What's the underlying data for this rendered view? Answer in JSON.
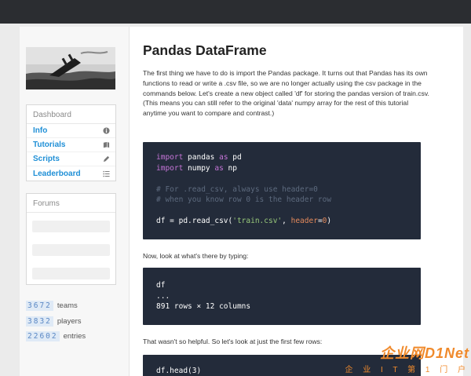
{
  "sidebar": {
    "dashboard_title": "Dashboard",
    "nav": [
      {
        "label": "Info",
        "icon": "info-icon"
      },
      {
        "label": "Tutorials",
        "icon": "book-icon"
      },
      {
        "label": "Scripts",
        "icon": "pencil-icon"
      },
      {
        "label": "Leaderboard",
        "icon": "list-icon"
      }
    ],
    "forums_title": "Forums",
    "stats": [
      {
        "value": "3672",
        "label": "teams"
      },
      {
        "value": "3832",
        "label": "players"
      },
      {
        "value": "22602",
        "label": "entries"
      }
    ]
  },
  "main": {
    "title": "Pandas DataFrame",
    "intro": "The first thing we have to do is import the Pandas package. It turns out that Pandas has its own functions to read or write a .csv file, so we are no longer actually using the csv package in the commands below. Let's create a new object called 'df' for storing the pandas version of train.csv. (This means you can still refer to the original 'data' numpy array for the rest of this tutorial anytime you want to compare and contrast.)",
    "code1": {
      "l1_kw": "import",
      "l1_mod": " pandas ",
      "l1_as": "as",
      "l1_alias": " pd",
      "l2_kw": "import",
      "l2_mod": " numpy ",
      "l2_as": "as",
      "l2_alias": " np",
      "c1": "# For .read_csv, always use header=0",
      "c2": "# when you know row 0 is the header row",
      "l5_a": "df = pd.read_csv(",
      "l5_str": "'train.csv'",
      "l5_b": ", ",
      "l5_param": "header",
      "l5_c": "=",
      "l5_num": "0",
      "l5_d": ")"
    },
    "para2": "Now, look at what's there by typing:",
    "code2": [
      "df",
      "...",
      "891 rows × 12 columns"
    ],
    "para3": "That wasn't so helpful. So let's look at just the first few rows:",
    "code3": [
      "df.head(3)"
    ]
  },
  "watermark": {
    "line1": "企业网D1Net",
    "line2": "企 业 I T 第 1 门 户"
  },
  "colors": {
    "link": "#1f8fd6",
    "code_bg": "#232b3a",
    "keyword": "#c775d9",
    "string": "#98c87a",
    "topbar": "#2b2d31"
  }
}
